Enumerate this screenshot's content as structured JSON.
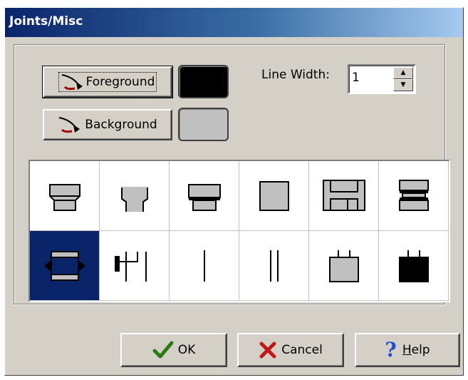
{
  "window": {
    "title": "Joints/Misc"
  },
  "colors": {
    "foreground_swatch": "#000000",
    "background_swatch": "#c0c0c0",
    "selection": "#0a246a",
    "symbol_fill": "#c0c0c0"
  },
  "controls": {
    "foreground_label": "Foreground",
    "background_label": "Background",
    "line_width_label": "Line Width:",
    "line_width_value": "1"
  },
  "symbols": [
    {
      "icon": "joint-tapered-box-icon"
    },
    {
      "icon": "joint-tapered-outline-icon"
    },
    {
      "icon": "joint-box-on-box-icon"
    },
    {
      "icon": "joint-square-icon"
    },
    {
      "icon": "joint-floppy-icon"
    },
    {
      "icon": "joint-stacked-icon"
    },
    {
      "icon": "joint-collar-arrows-icon",
      "selected": true
    },
    {
      "icon": "joint-valve-lines-icon"
    },
    {
      "icon": "single-line-icon"
    },
    {
      "icon": "double-line-icon"
    },
    {
      "icon": "box-with-ticks-icon"
    },
    {
      "icon": "filled-box-with-ticks-icon"
    }
  ],
  "buttons": {
    "ok": "OK",
    "cancel": "Cancel",
    "help_u": "H",
    "help_rest": "elp"
  }
}
